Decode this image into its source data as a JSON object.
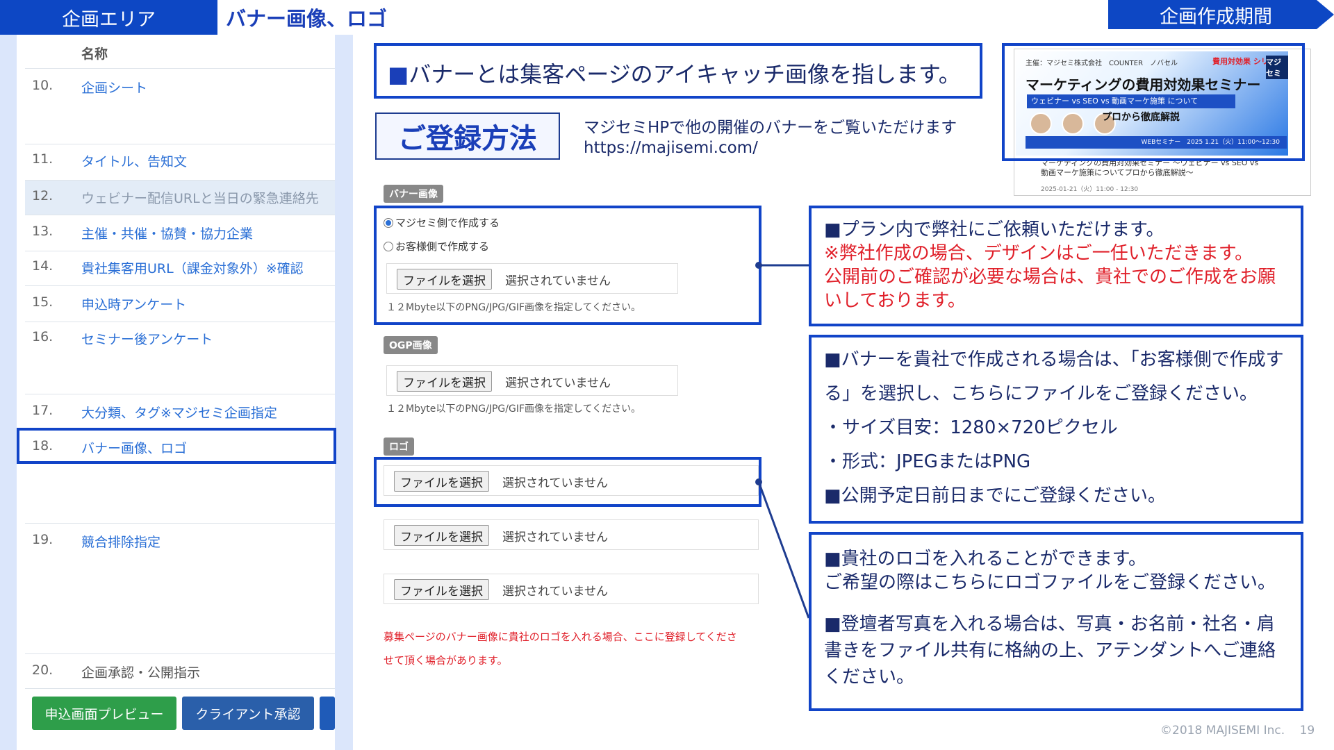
{
  "header": {
    "tab_area": "企画エリア",
    "page_heading": "バナー画像、ロゴ",
    "period_label": "企画作成期間"
  },
  "sidebar": {
    "column_header": "名称",
    "items": [
      {
        "num": "10.",
        "label": "企画シート"
      },
      {
        "num": "11.",
        "label": "タイトル、告知文"
      },
      {
        "num": "12.",
        "label": "ウェビナー配信URLと当日の緊急連絡先"
      },
      {
        "num": "13.",
        "label": "主催・共催・協賛・協力企業"
      },
      {
        "num": "14.",
        "label": "貴社集客用URL（課金対象外）※確認"
      },
      {
        "num": "15.",
        "label": "申込時アンケート"
      },
      {
        "num": "16.",
        "label": "セミナー後アンケート"
      },
      {
        "num": "17.",
        "label": "大分類、タグ※マジセミ企画指定"
      },
      {
        "num": "18.",
        "label": "バナー画像、ロゴ"
      },
      {
        "num": "19.",
        "label": "競合排除指定"
      },
      {
        "num": "20.",
        "label": "企画承認・公開指示"
      }
    ],
    "buttons": {
      "preview": "申込画面プレビュー",
      "client_approval": "クライアント承認"
    }
  },
  "intro": "バナーとは集客ページのアイキャッチ画像を指します。",
  "registration": {
    "title": "ご登録方法",
    "note_line1": "マジセミHPで他の開催のバナーをご覧いただけます",
    "note_url": "https://majisemi.com/"
  },
  "banner_preview": {
    "sponsor": "主催：マジセミ株式会社　COUNTER　ノバセル",
    "series": "費用対効果 シリーズ",
    "logo": "マジセミ",
    "title": "マーケティングの費用対効果セミナー",
    "subtitle": "ウェビナー vs SEO vs 動画マーケ施策 について",
    "pro_line": "プロから徹底解説",
    "strip": "WEBセミナー　2025 1.21（火）11:00～12:30",
    "caption_line1": "マーケティングの費用対効果セミナー ～ウェビナー vs SEO vs",
    "caption_line2": "動画マーケ施策についてプロから徹底解説～",
    "caption_line3": "2025-01-21（火）11:00 - 12:30"
  },
  "form": {
    "banner_tag": "バナー画像",
    "radio_majisemi": "マジセミ側で作成する",
    "radio_customer": "お客様側で作成する",
    "file_button": "ファイルを選択",
    "file_status": "選択されていません",
    "size_hint": "１２Mbyte以下のPNG/JPG/GIF画像を指定してください。",
    "ogp_tag": "OGP画像",
    "logo_tag": "ロゴ",
    "logo_note_line1": "募集ページのバナー画像に貴社のロゴを入れる場合、ここに登録してくださ",
    "logo_note_line2": "せて頂く場合があります。"
  },
  "info_plan": {
    "line1": "■プラン内で弊社にご依頼いただけます。",
    "line2": "※弊社作成の場合、デザインはご一任いただきます。",
    "line3": "公開前のご確認が必要な場合は、貴社でのご作成をお願いしております。"
  },
  "info_customer": {
    "line1": "■バナーを貴社で作成される場合は、「お客様側で作成する」を選択し、こちらにファイルをご登録ください。",
    "line2": "・サイズ目安：1280×720ピクセル",
    "line3": "・形式：JPEGまたはPNG",
    "line4": "■公開予定日前日までにご登録ください。"
  },
  "info_logo": {
    "line1": "■貴社のロゴを入れることができます。",
    "line2": "ご希望の際はこちらにロゴファイルをご登録ください。",
    "line3": "■登壇者写真を入れる場合は、写真・お名前・社名・肩書きをファイル共有に格納の上、アテンダントへご連絡ください。"
  },
  "footer": {
    "copyright": "©2018 MAJISEMI Inc.",
    "page_number": "19"
  },
  "colors": {
    "accent": "#1144c8",
    "header_blue": "#0d47c4",
    "red_text": "#e0202a",
    "green_button": "#2e9e4a"
  }
}
